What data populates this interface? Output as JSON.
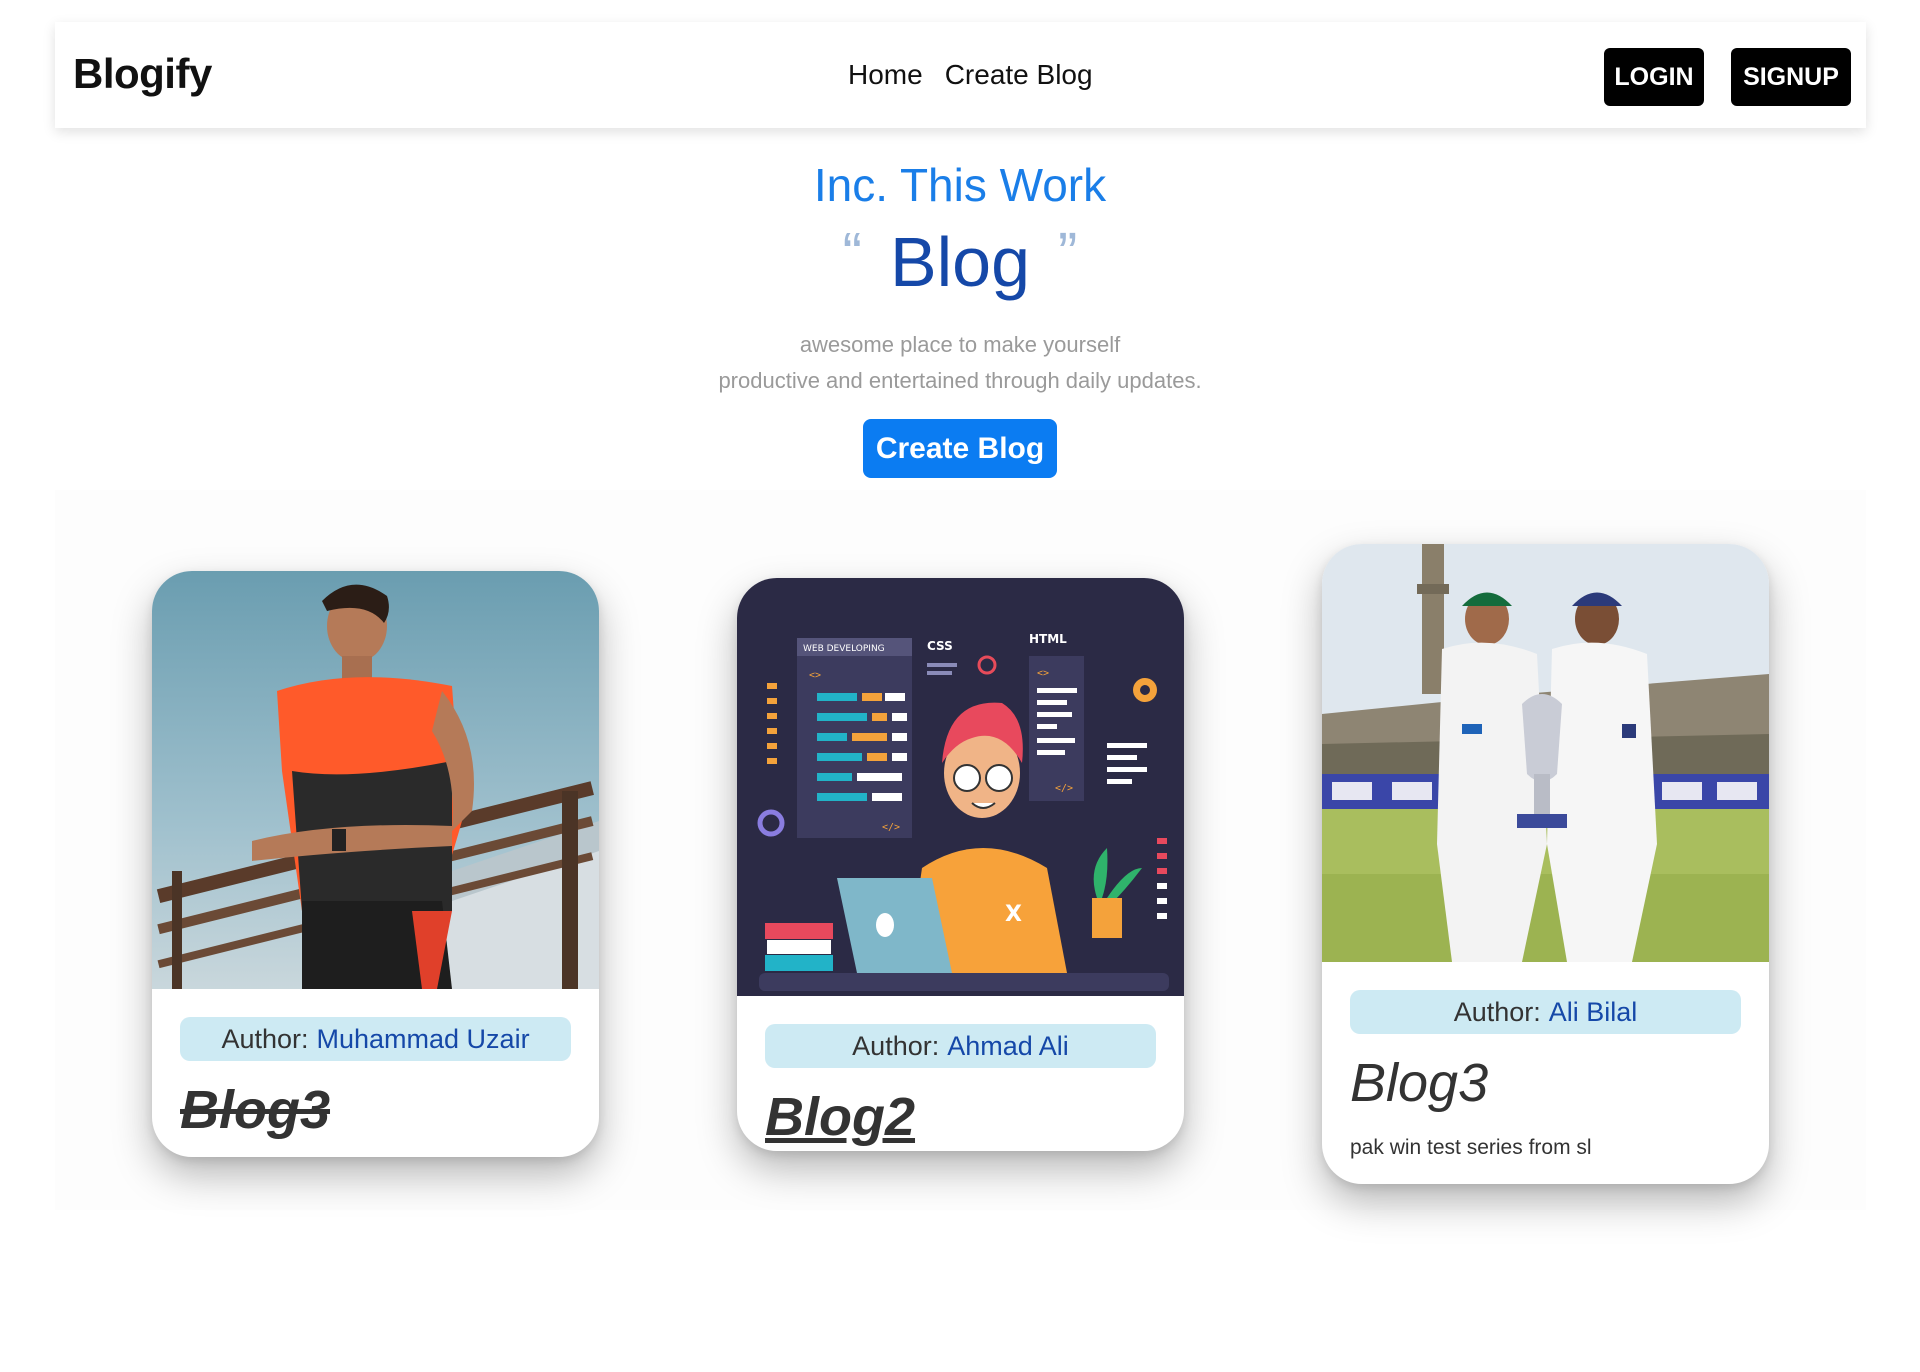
{
  "navbar": {
    "brand": "Blogify",
    "links": [
      "Home",
      "Create Blog"
    ],
    "login_label": "LOGIN",
    "signup_label": "SIGNUP"
  },
  "hero": {
    "subtitle": "Inc. This Work",
    "quote_open": "“",
    "title": "Blog",
    "quote_close": "”",
    "desc_line1": "awesome place to make yourself",
    "desc_line2": "productive and entertained through daily updates.",
    "cta_label": "Create Blog"
  },
  "cards": [
    {
      "author_prefix": "Author:",
      "author_name": "Muhammad Uzair",
      "title": "Blog3",
      "description": "",
      "image": "man-in-orange-shirt-photo"
    },
    {
      "author_prefix": "Author:",
      "author_name": "Ahmad Ali",
      "title": "Blog2",
      "description": "",
      "image": "web-developing-illustration"
    },
    {
      "author_prefix": "Author:",
      "author_name": "Ali Bilal",
      "title": "Blog3",
      "description": "pak win test series from sl",
      "image": "cricket-trophy-photo"
    }
  ],
  "illustration_text": {
    "panel_label": "WEB DEVELOPING",
    "css": "CSS",
    "html": "HTML",
    "code": "</>",
    "brackets": "<>",
    "shirt": "X"
  },
  "colors": {
    "accent_blue": "#0b7cf2",
    "title_blue": "#1548a8",
    "author_bg": "#cdeaf3",
    "nav_button_bg": "#000000"
  }
}
